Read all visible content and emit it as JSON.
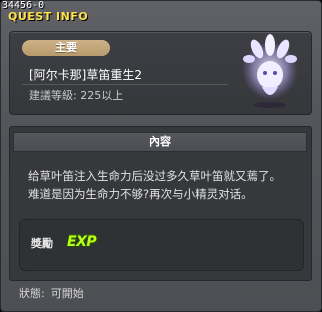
{
  "window": {
    "quest_id": "34456-0",
    "title": "QUEST INFO"
  },
  "quest": {
    "tag": "主要",
    "name": "[阿尔卡那]草笛重生2",
    "level": "建議等級: 225以上",
    "npc_icon": "spirit-creature-icon"
  },
  "content": {
    "header": "內容",
    "lines": [
      "给草叶笛注入生命力后没过多久草叶笛就又蔫了。",
      "难道是因为生命力不够?再次与小精灵对话。"
    ]
  },
  "reward": {
    "label": "獎勵",
    "exp": "EXP"
  },
  "status": {
    "label": "狀態:",
    "value": "可開始"
  },
  "colors": {
    "title": "#ffe14d",
    "tag_bg": "#c4a87b",
    "exp": "#b8ff1a"
  }
}
